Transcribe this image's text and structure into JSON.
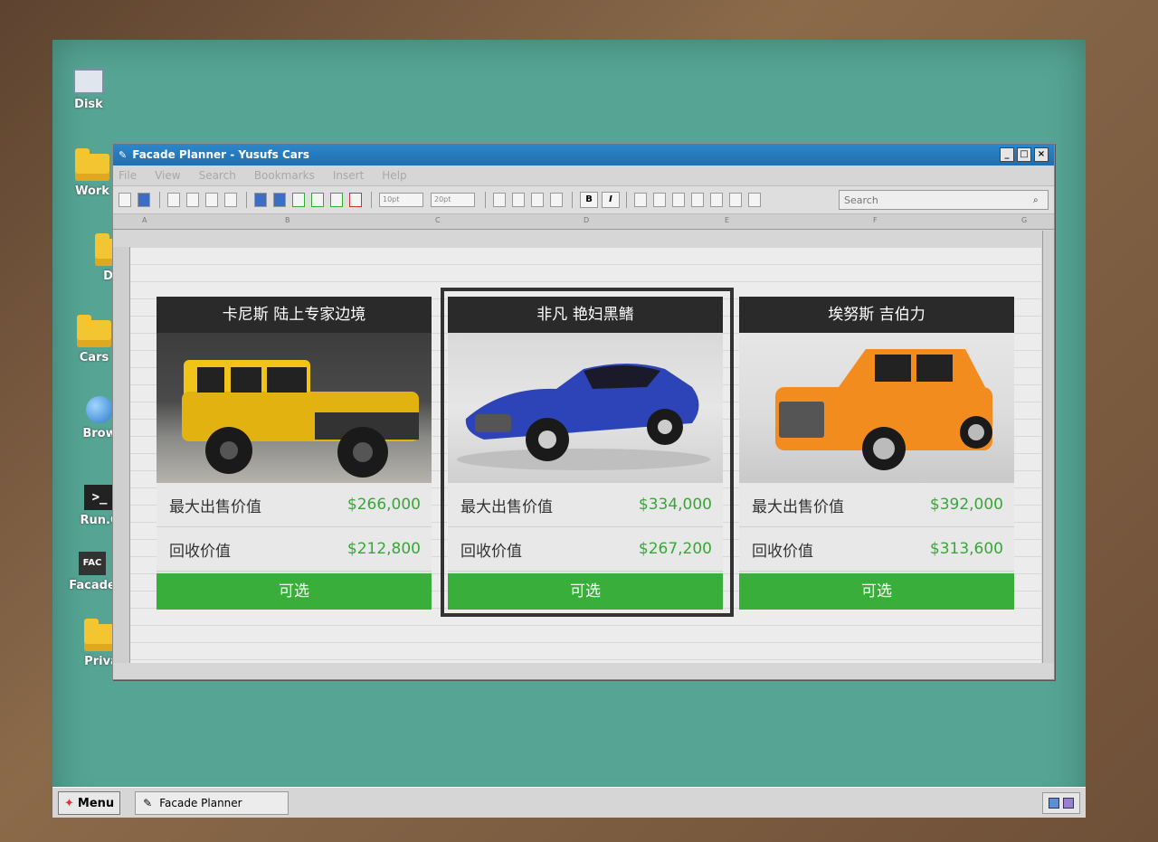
{
  "desktop": {
    "icons": [
      {
        "label": "Disk"
      },
      {
        "label": "Work"
      },
      {
        "label": "Do"
      },
      {
        "label": "Cars"
      },
      {
        "label": "Brow"
      },
      {
        "label": "Run.C"
      },
      {
        "label": "Facade"
      },
      {
        "label": "Priva"
      }
    ]
  },
  "window": {
    "title": "Facade Planner - Yusufs Cars",
    "menu": [
      "File",
      "View",
      "Search",
      "Bookmarks",
      "Insert",
      "Help"
    ],
    "search_placeholder": "Search",
    "font_size_a": "10pt",
    "font_size_b": "20pt",
    "bold_label": "B",
    "italic_label": "I",
    "columns": [
      "A",
      "B",
      "C",
      "D",
      "E",
      "F",
      "G"
    ]
  },
  "cards": [
    {
      "name": "卡尼斯 陆上专家边境",
      "max_label": "最大出售价值",
      "max_value": "$266,000",
      "resale_label": "回收价值",
      "resale_value": "$212,800",
      "status": "可选",
      "car_color": "#f0c419"
    },
    {
      "name": "非凡 艳妇黑鳍",
      "max_label": "最大出售价值",
      "max_value": "$334,000",
      "resale_label": "回收价值",
      "resale_value": "$267,200",
      "status": "可选",
      "car_color": "#2c44b8"
    },
    {
      "name": "埃努斯 吉伯力",
      "max_label": "最大出售价值",
      "max_value": "$392,000",
      "resale_label": "回收价值",
      "resale_value": "$313,600",
      "status": "可选",
      "car_color": "#f28c1e"
    }
  ],
  "taskbar": {
    "menu_label": "Menu",
    "task_label": "Facade Planner"
  }
}
